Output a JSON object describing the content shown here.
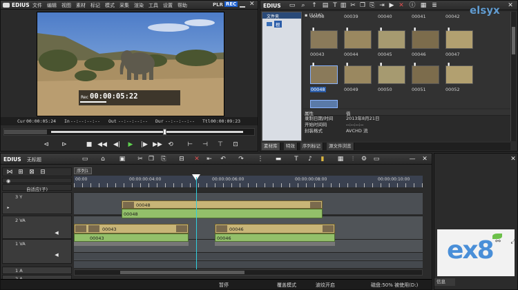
{
  "player": {
    "logo": "EDIUS",
    "menu": [
      "文件",
      "编辑",
      "视图",
      "素材",
      "标记",
      "模式",
      "采集",
      "渲染",
      "工具",
      "设置",
      "帮助"
    ],
    "plr": "PLR",
    "rec": "REC",
    "overlay_tc_label": "Rec",
    "overlay_tc": "00:00:05:22",
    "tc_cur_label": "Cur",
    "tc_cur": "00:00:05:24",
    "tc_in_label": "In",
    "tc_in": "--:--:--:--",
    "tc_out_label": "Out",
    "tc_out": "--:--:--:--",
    "tc_dur_label": "Dur",
    "tc_dur": "--:--:--:--",
    "tc_ttl_label": "Ttl",
    "tc_ttl": "00:00:09:23"
  },
  "bin": {
    "logo": "EDIUS",
    "folder_header": "文件夹",
    "root_folder": "根",
    "path_count": "(1/16)",
    "clips_row0": [
      "00038",
      "00039",
      "00040",
      "00041",
      "00042"
    ],
    "clips_row1": [
      "00043",
      "00044",
      "00045",
      "00046",
      "00047"
    ],
    "clips_row2": [
      "00048",
      "00049",
      "00050",
      "00051",
      "00052"
    ],
    "selected_clip": "00048",
    "props_header_key": "属性",
    "props_header_val": "值",
    "props": [
      {
        "k": "录制日期/时间",
        "v": "2013年8月21日"
      },
      {
        "k": "开始时间码",
        "v": "--:--:--:--"
      },
      {
        "k": "封装格式",
        "v": "AVCHD 流"
      }
    ],
    "tabs": [
      "素材库",
      "特效",
      "序列标记",
      "源文件浏览"
    ]
  },
  "timeline": {
    "logo": "EDIUS",
    "project": "无标题",
    "sequence_tab": "序列1",
    "track_mode": "自适应(子)",
    "ruler": [
      "00:00",
      "00:00:00:04:00",
      "00:00:00:06:00",
      "00:00:00:08:00",
      "00:00:00:10:00"
    ],
    "tracks": {
      "t3": "3 Y",
      "t2": "2 VA",
      "t1": "1 VA",
      "a1": "1 A",
      "a2": "2 A"
    },
    "clips": {
      "v2_video": "00048",
      "v2_audio": "00048",
      "v1_clip1_video": "00043",
      "v1_clip1_audio": "00043",
      "v1_clip2_video": "00046",
      "v1_clip2_audio": "00046"
    },
    "status": {
      "pause": "暂停",
      "overwrite": "覆盖模式",
      "ripple": "波纹开启",
      "disk": "磁盘:50% 被使用(D:)"
    }
  },
  "right_panel": {
    "info_tab": "信息"
  },
  "watermark_top": "elsyx",
  "watermark_bottom": "ex8"
}
